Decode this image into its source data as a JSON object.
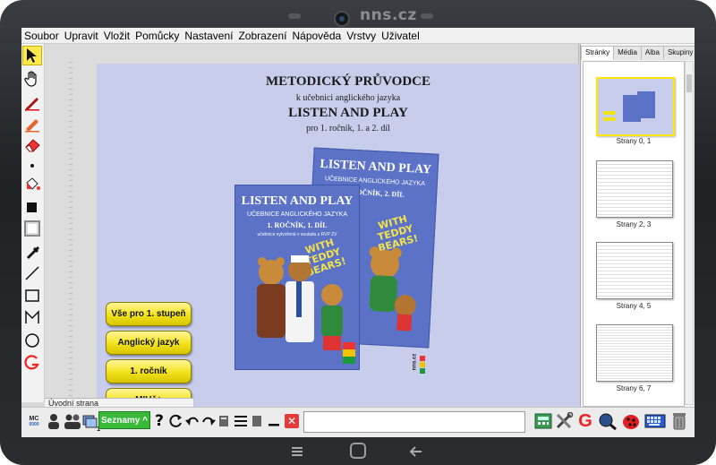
{
  "device": {
    "brand": "nns.cz"
  },
  "menu": [
    "Soubor",
    "Upravit",
    "Vložit",
    "Pomůcky",
    "Nastavení",
    "Zobrazení",
    "Nápověda",
    "Vrstvy",
    "Uživatel"
  ],
  "left_tools": [
    "pointer-icon",
    "hand-icon",
    "pen-icon",
    "highlighter-icon",
    "eraser-icon",
    "dot-icon",
    "fill-icon",
    "filled-square-icon",
    "frame-square-icon",
    "eyedropper-icon",
    "line-icon",
    "rectangle-icon",
    "polyline-icon",
    "ellipse-icon",
    "g-icon"
  ],
  "document": {
    "title": "METODICKÝ PRŮVODCE",
    "subtitle": "k učebnici anglického jazyka",
    "book_title": "LISTEN AND PLAY",
    "edition": "pro 1. ročník, 1. a 2. díl",
    "book_front": {
      "title": "LISTEN AND PLAY",
      "subtitle": "UČEBNICE ANGLICKÉHO JAZYKA",
      "part": "1. ROČNÍK, 1. DÍL",
      "note": "učebnice vytvořená v souladu s RVP ZV",
      "badge_line1": "WITH",
      "badge_line2": "TEDDY BEARS!"
    },
    "book_back": {
      "title": "LISTEN AND PLAY",
      "subtitle": "UČEBNICE ANGLICKÉHO JAZYKA",
      "part": "1. ROČNÍK, 2. DÍL",
      "badge_line1": "WITH",
      "badge_line2": "TEDDY BEARS!"
    },
    "logo_text": "nns.cz"
  },
  "nav_buttons": {
    "b1": "Vše pro 1. stupeň",
    "b2": "Anglický jazyk",
    "b3": "1. ročník",
    "b4": "MIUč+"
  },
  "page_tab": "Úvodní strana",
  "panel": {
    "tabs": [
      "Stránky",
      "Média",
      "Alba",
      "Skupiny"
    ],
    "pages": [
      "Strany 0, 1",
      "Strany 2, 3",
      "Strany 4, 5",
      "Strany 6, 7"
    ]
  },
  "bottom": {
    "mc_label": "MC",
    "mc_sub": "0000",
    "badge_number": "1",
    "seznamy_label": "Seznamy ^",
    "help_glyph": "?",
    "g_glyph": "G",
    "close_glyph": "✕"
  },
  "colors": {
    "page_bg": "#c7cdea",
    "book_blue": "#5b72c7",
    "button_yellow": "#f2e21a",
    "seznamy_green": "#39b93a"
  }
}
